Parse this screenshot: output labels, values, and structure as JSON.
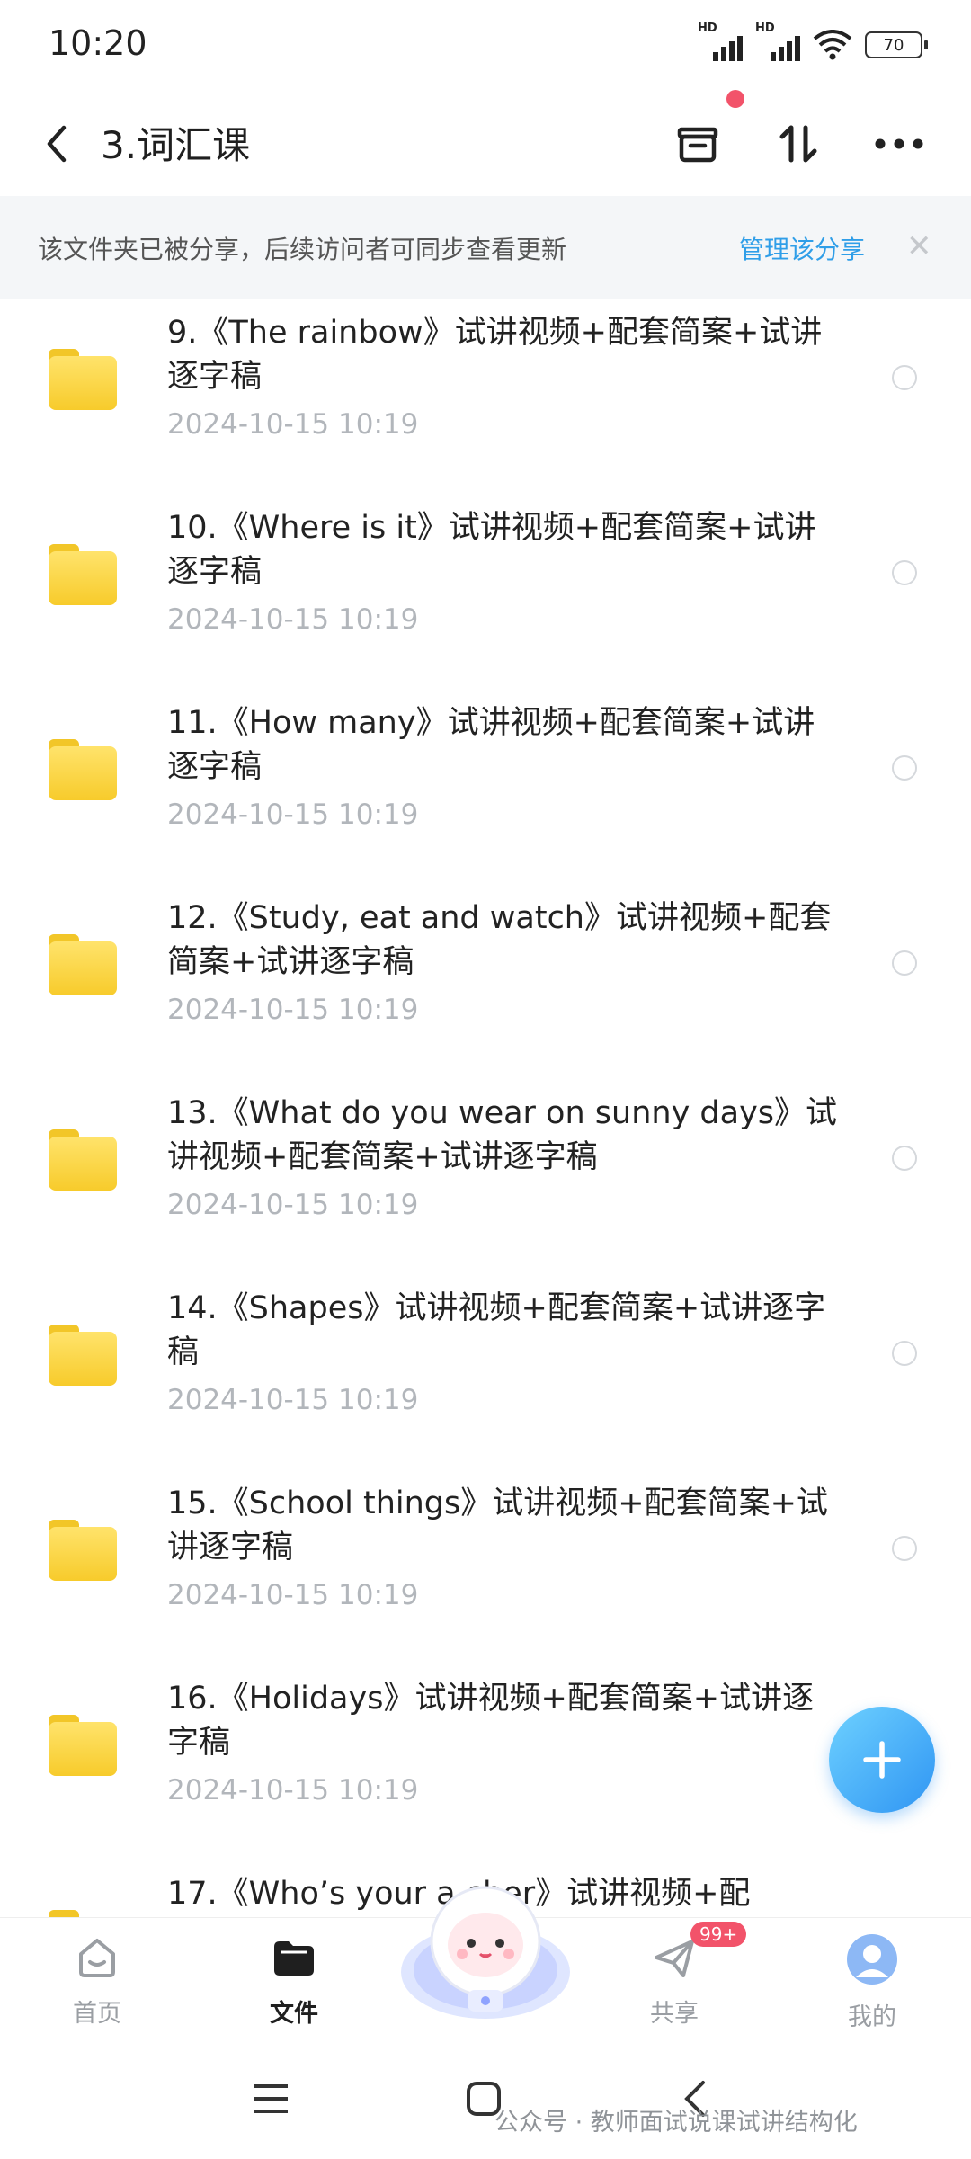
{
  "status_bar": {
    "time": "10:20",
    "signal1_label": "HD",
    "signal2_label": "HD",
    "battery": "70"
  },
  "title_bar": {
    "title": "3.词汇课"
  },
  "share_banner": {
    "text": "该文件夹已被分享，后续访问者可同步查看更新",
    "link": "管理该分享"
  },
  "files": [
    {
      "line1": "9.《The rainbow》试讲视频+配套简案+试讲",
      "line2": "逐字稿",
      "date": "2024-10-15  10:19"
    },
    {
      "line1": "10.《Where is it》试讲视频+配套简案+试讲",
      "line2": "逐字稿",
      "date": "2024-10-15  10:19"
    },
    {
      "line1": "11.《How many》试讲视频+配套简案+试讲",
      "line2": "逐字稿",
      "date": "2024-10-15  10:19"
    },
    {
      "line1": "12.《Study, eat and watch》试讲视频+配套",
      "line2": "简案+试讲逐字稿",
      "date": "2024-10-15  10:19"
    },
    {
      "line1": "13.《What do you wear on sunny days》试",
      "line2": "讲视频+配套简案+试讲逐字稿",
      "date": "2024-10-15  10:19"
    },
    {
      "line1": "14.《Shapes》试讲视频+配套简案+试讲逐字",
      "line2": "稿",
      "date": "2024-10-15  10:19"
    },
    {
      "line1": "15.《School things》试讲视频+配套简案+试",
      "line2": "讲逐字稿",
      "date": "2024-10-15  10:19"
    },
    {
      "line1": "16.《Holidays》试讲视频+配套简案+试讲逐",
      "line2": "字稿",
      "date": "2024-10-15  10:19"
    },
    {
      "line1": "17.《Who’s your a      cher》试讲视频+配",
      "line2": "",
      "date": ""
    }
  ],
  "bottom_nav": {
    "home": "首页",
    "files": "文件",
    "share": "共享",
    "share_badge": "99+",
    "mine": "我的"
  },
  "watermark": "公众号 · 教师面试说课试讲结构化"
}
